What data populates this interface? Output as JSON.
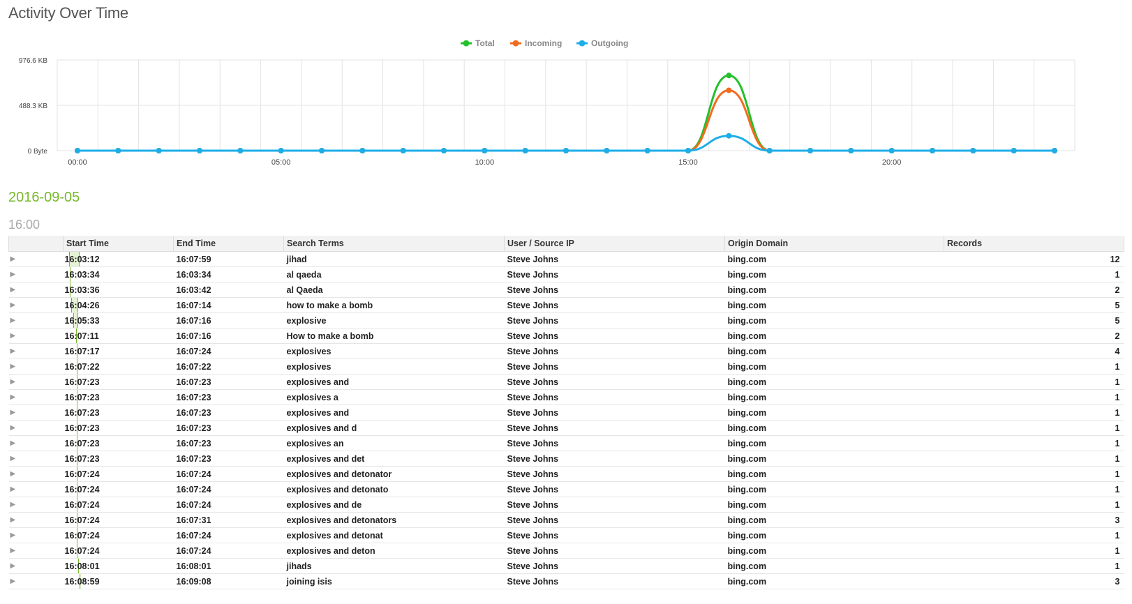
{
  "page_title": "Activity Over Time",
  "chart_data": {
    "type": "line",
    "legend": [
      "Total",
      "Incoming",
      "Outgoing"
    ],
    "legend_position": "top-center",
    "colors": {
      "Total": "#22c02a",
      "Incoming": "#f46b1d",
      "Outgoing": "#1daee8",
      "grid": "#e3e3e3",
      "axis_text": "#444444"
    },
    "x_ticks": [
      "00:00",
      "05:00",
      "10:00",
      "15:00",
      "20:00"
    ],
    "y_ticks": [
      "976.6 KB",
      "488.3 KB",
      "0 Byte"
    ],
    "ylim_kb": [
      0,
      976.6
    ],
    "x_hours": [
      0,
      1,
      2,
      3,
      4,
      5,
      6,
      7,
      8,
      9,
      10,
      11,
      12,
      13,
      14,
      15,
      16,
      17,
      18,
      19,
      20,
      21,
      22,
      23,
      24
    ],
    "series": [
      {
        "name": "Total",
        "values_kb": [
          0,
          0,
          0,
          0,
          0,
          0,
          0,
          0,
          0,
          0,
          0,
          0,
          0,
          0,
          0,
          0,
          810,
          0,
          0,
          0,
          0,
          0,
          0,
          0,
          0
        ]
      },
      {
        "name": "Incoming",
        "values_kb": [
          0,
          0,
          0,
          0,
          0,
          0,
          0,
          0,
          0,
          0,
          0,
          0,
          0,
          0,
          0,
          0,
          650,
          0,
          0,
          0,
          0,
          0,
          0,
          0,
          0
        ]
      },
      {
        "name": "Outgoing",
        "values_kb": [
          0,
          0,
          0,
          0,
          0,
          0,
          0,
          0,
          0,
          0,
          0,
          0,
          0,
          0,
          0,
          0,
          160,
          0,
          0,
          0,
          0,
          0,
          0,
          0,
          0
        ]
      }
    ],
    "grid": true
  },
  "group": {
    "date": "2016-09-05",
    "hour": "16:00"
  },
  "table": {
    "columns": [
      "Start Time",
      "End Time",
      "Search Terms",
      "User / Source IP",
      "Origin Domain",
      "Records"
    ],
    "timeline_range": [
      "16:00:00",
      "17:00:00"
    ],
    "rows": [
      {
        "start": "16:03:12",
        "end": "16:07:59",
        "terms": "jihad",
        "user": "Steve Johns",
        "domain": "bing.com",
        "records": "12"
      },
      {
        "start": "16:03:34",
        "end": "16:03:34",
        "terms": "al qaeda",
        "user": "Steve Johns",
        "domain": "bing.com",
        "records": "1"
      },
      {
        "start": "16:03:36",
        "end": "16:03:42",
        "terms": "al Qaeda",
        "user": "Steve Johns",
        "domain": "bing.com",
        "records": "2"
      },
      {
        "start": "16:04:26",
        "end": "16:07:14",
        "terms": "how to make a bomb",
        "user": "Steve Johns",
        "domain": "bing.com",
        "records": "5"
      },
      {
        "start": "16:05:33",
        "end": "16:07:16",
        "terms": "explosive",
        "user": "Steve Johns",
        "domain": "bing.com",
        "records": "5"
      },
      {
        "start": "16:07:11",
        "end": "16:07:16",
        "terms": "How to make a bomb",
        "user": "Steve Johns",
        "domain": "bing.com",
        "records": "2"
      },
      {
        "start": "16:07:17",
        "end": "16:07:24",
        "terms": "explosives",
        "user": "Steve Johns",
        "domain": "bing.com",
        "records": "4"
      },
      {
        "start": "16:07:22",
        "end": "16:07:22",
        "terms": "explosives",
        "user": "Steve Johns",
        "domain": "bing.com",
        "records": "1"
      },
      {
        "start": "16:07:23",
        "end": "16:07:23",
        "terms": "explosives and",
        "user": "Steve Johns",
        "domain": "bing.com",
        "records": "1"
      },
      {
        "start": "16:07:23",
        "end": "16:07:23",
        "terms": "explosives a",
        "user": "Steve Johns",
        "domain": "bing.com",
        "records": "1"
      },
      {
        "start": "16:07:23",
        "end": "16:07:23",
        "terms": "explosives and",
        "user": "Steve Johns",
        "domain": "bing.com",
        "records": "1"
      },
      {
        "start": "16:07:23",
        "end": "16:07:23",
        "terms": "explosives and d",
        "user": "Steve Johns",
        "domain": "bing.com",
        "records": "1"
      },
      {
        "start": "16:07:23",
        "end": "16:07:23",
        "terms": "explosives an",
        "user": "Steve Johns",
        "domain": "bing.com",
        "records": "1"
      },
      {
        "start": "16:07:23",
        "end": "16:07:23",
        "terms": "explosives and det",
        "user": "Steve Johns",
        "domain": "bing.com",
        "records": "1"
      },
      {
        "start": "16:07:24",
        "end": "16:07:24",
        "terms": "explosives and detonator",
        "user": "Steve Johns",
        "domain": "bing.com",
        "records": "1"
      },
      {
        "start": "16:07:24",
        "end": "16:07:24",
        "terms": "explosives and detonato",
        "user": "Steve Johns",
        "domain": "bing.com",
        "records": "1"
      },
      {
        "start": "16:07:24",
        "end": "16:07:24",
        "terms": "explosives and de",
        "user": "Steve Johns",
        "domain": "bing.com",
        "records": "1"
      },
      {
        "start": "16:07:24",
        "end": "16:07:31",
        "terms": "explosives and detonators",
        "user": "Steve Johns",
        "domain": "bing.com",
        "records": "3"
      },
      {
        "start": "16:07:24",
        "end": "16:07:24",
        "terms": "explosives and detonat",
        "user": "Steve Johns",
        "domain": "bing.com",
        "records": "1"
      },
      {
        "start": "16:07:24",
        "end": "16:07:24",
        "terms": "explosives and deton",
        "user": "Steve Johns",
        "domain": "bing.com",
        "records": "1"
      },
      {
        "start": "16:08:01",
        "end": "16:08:01",
        "terms": "jihads",
        "user": "Steve Johns",
        "domain": "bing.com",
        "records": "1"
      },
      {
        "start": "16:08:59",
        "end": "16:09:08",
        "terms": "joining isis",
        "user": "Steve Johns",
        "domain": "bing.com",
        "records": "3"
      }
    ]
  },
  "icons": {
    "expand": "caret-right-icon",
    "legend_marker": "dot-line-icon"
  }
}
